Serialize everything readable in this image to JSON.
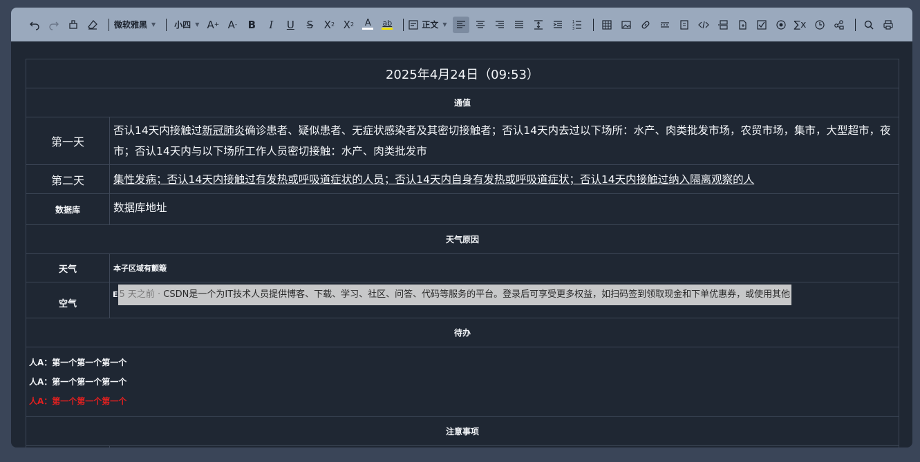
{
  "toolbar": {
    "font_family": "微软雅黑",
    "font_size": "小四",
    "paragraph_style": "正文",
    "icons": [
      "undo-icon",
      "redo-icon",
      "format-painter-icon",
      "clear-format-icon",
      "font-family-dropdown",
      "font-size-dropdown",
      "increase-font-icon",
      "decrease-font-icon",
      "bold-icon",
      "italic-icon",
      "underline-icon",
      "strikethrough-icon",
      "superscript-icon",
      "subscript-icon",
      "font-color-icon",
      "highlight-icon",
      "paragraph-style-dropdown",
      "align-left-icon",
      "align-center-icon",
      "align-right-icon",
      "justify-icon",
      "line-height-icon",
      "indent-icon",
      "list-icon",
      "table-icon",
      "image-icon",
      "link-icon",
      "separator-icon",
      "watermark-icon",
      "code-icon",
      "page-break-icon",
      "control-icon",
      "checkbox-icon",
      "radio-icon",
      "latex-icon",
      "date-icon",
      "block-icon",
      "search-icon",
      "print-icon"
    ]
  },
  "doc": {
    "title": "2025年4月24日（09:53）",
    "section1": "通值",
    "day1_label": "第一天",
    "day1_pre": "否认14天内接触过",
    "day1_link": "新冠肺炎",
    "day1_post": "确诊患者、疑似患者、无症状感染者及其密切接触者；否认14天内去过以下场所：水产、肉类批发市场，农贸市场，集市，大型超市，夜市；否认14天内与以下场所工作人员密切接触：水产、肉类批发市",
    "day2_label": "第二天",
    "day2_text": "集性发病；否认14天内接触过有发热或呼吸道症状的人员；否认14天内自身有发热或呼吸道症状；否认14天内接触过纳入隔离观察的人",
    "db_label": "数据库",
    "db_value": "数据库地址",
    "section2": "天气原因",
    "weather_label": "天气",
    "weather_value": "本子区域有颤簸",
    "air_label": "空气",
    "air_prefix": "E",
    "air_meta": "5 天之前 · ",
    "air_text": "CSDN是一个为IT技术人员提供博客、下载、学习、社区、问答、代码等服务的平台。登录后可享受更多权益，如扫码签到领取现金和下单优惠券，或使用其他",
    "section3": "待办",
    "todos": [
      "人A：第一个第一个第一个",
      "人A：第一个第一个第一个",
      "人A：第一个第一个第一个"
    ],
    "section4": "注意事项"
  },
  "colors": {
    "toolbar_bg": "#9aa9bd",
    "editor_bg": "#1f2733",
    "todo_red": "#e02020"
  }
}
